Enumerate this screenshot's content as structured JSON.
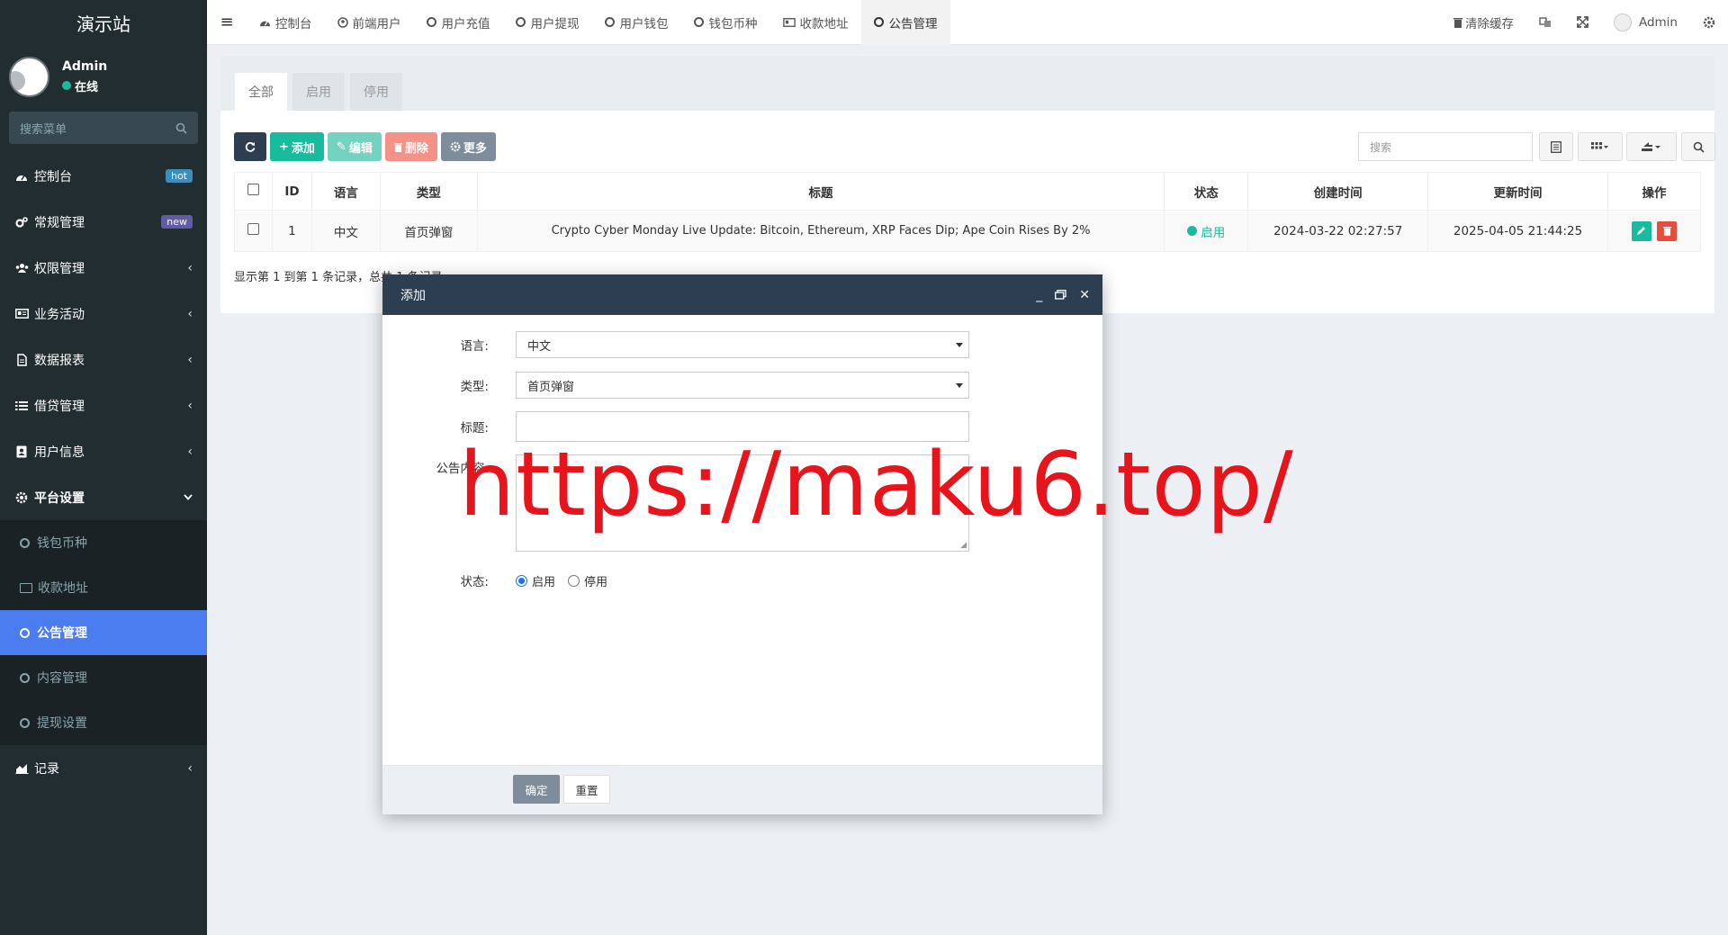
{
  "brand": "演示站",
  "user": {
    "name": "Admin",
    "status": "在线"
  },
  "menu_search_placeholder": "搜索菜单",
  "menu": [
    {
      "label": "控制台",
      "icon": "dashboard-icon",
      "badge": "hot",
      "badge_color": "#3c8dbc"
    },
    {
      "label": "常规管理",
      "icon": "cogs-icon",
      "badge": "new",
      "badge_color": "#605ca8"
    },
    {
      "label": "权限管理",
      "icon": "group-icon"
    },
    {
      "label": "业务活动",
      "icon": "id-card-icon"
    },
    {
      "label": "数据报表",
      "icon": "file-icon"
    },
    {
      "label": "借贷管理",
      "icon": "list-icon"
    },
    {
      "label": "用户信息",
      "icon": "address-book-icon"
    },
    {
      "label": "平台设置",
      "icon": "gear-icon",
      "expanded": true
    }
  ],
  "submenu": [
    {
      "label": "钱包币种",
      "icon": "ring"
    },
    {
      "label": "收款地址",
      "icon": "card"
    },
    {
      "label": "公告管理",
      "icon": "ring",
      "active": true
    },
    {
      "label": "内容管理",
      "icon": "ring"
    },
    {
      "label": "提现设置",
      "icon": "ring"
    }
  ],
  "menu_tail": {
    "label": "记录",
    "icon": "area-chart-icon"
  },
  "topnav": {
    "tabs": [
      {
        "label": "控制台",
        "icon": "dashboard"
      },
      {
        "label": "前端用户",
        "icon": "user"
      },
      {
        "label": "用户充值",
        "icon": "ring"
      },
      {
        "label": "用户提现",
        "icon": "ring"
      },
      {
        "label": "用户钱包",
        "icon": "ring"
      },
      {
        "label": "钱包币种",
        "icon": "ring"
      },
      {
        "label": "收款地址",
        "icon": "card"
      },
      {
        "label": "公告管理",
        "icon": "ring",
        "active": true
      }
    ],
    "clear_cache": "清除缓存",
    "user": "Admin"
  },
  "panel": {
    "tabs": [
      "全部",
      "启用",
      "停用"
    ],
    "toolbar": {
      "add": "添加",
      "edit": "编辑",
      "delete": "删除",
      "more": "更多"
    },
    "search_placeholder": "搜索",
    "columns": [
      "ID",
      "语言",
      "类型",
      "标题",
      "状态",
      "创建时间",
      "更新时间",
      "操作"
    ],
    "rows": [
      {
        "id": "1",
        "lang": "中文",
        "type": "首页弹窗",
        "title": "Crypto Cyber Monday Live Update: Bitcoin, Ethereum, XRP Faces Dip; Ape Coin Rises By 2%",
        "status": "启用",
        "created": "2024-03-22 02:27:57",
        "updated": "2025-04-05 21:44:25"
      }
    ],
    "page_info": "显示第 1 到第 1 条记录，总共 1 条记录"
  },
  "modal": {
    "title": "添加",
    "fields": {
      "lang_label": "语言:",
      "lang_value": "中文",
      "type_label": "类型:",
      "type_value": "首页弹窗",
      "title_label": "标题:",
      "title_value": "",
      "content_label": "公告内容:",
      "status_label": "状态:",
      "status_on": "启用",
      "status_off": "停用"
    },
    "confirm": "确定",
    "reset": "重置"
  },
  "watermark": "https://maku6.top/",
  "colors": {
    "sidebar_bg": "#222d32",
    "active_menu": "#4b7cf0",
    "add": "#18bc9c",
    "edit": "#74d2c0",
    "delete": "#f4928a",
    "more": "#7f8c99",
    "refresh": "#2c3e50",
    "watermark": "#e8141c"
  }
}
